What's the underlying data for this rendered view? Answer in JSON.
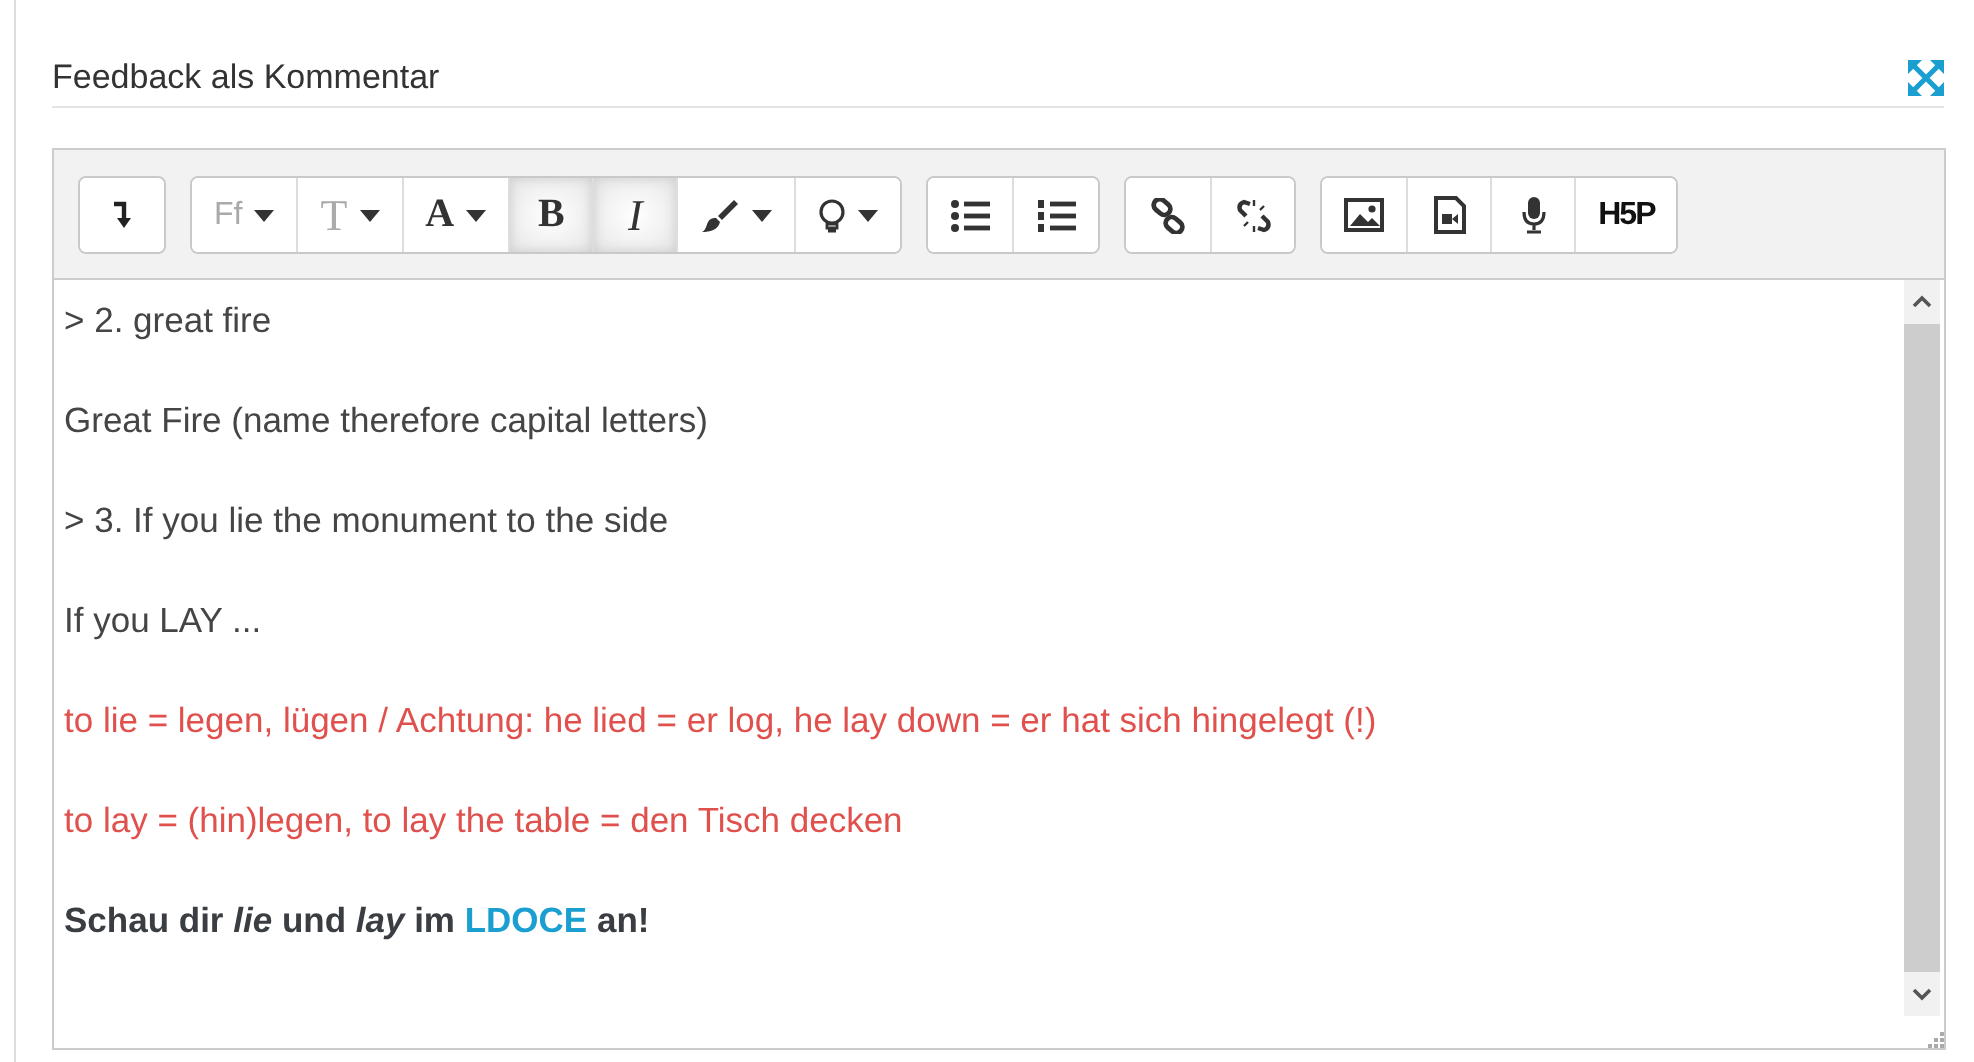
{
  "section": {
    "title": "Feedback als Kommentar"
  },
  "toolbar": {
    "groups": [
      {
        "buttons": [
          {
            "kind": "return",
            "pressed": false
          }
        ]
      },
      {
        "buttons": [
          {
            "kind": "font",
            "label": "Ff",
            "dropdown": true,
            "pressed": false
          },
          {
            "kind": "size",
            "label": "T",
            "dropdown": true,
            "pressed": false
          },
          {
            "kind": "serif",
            "label": "A",
            "dropdown": true,
            "pressed": false
          },
          {
            "kind": "serif",
            "label": "B",
            "dropdown": false,
            "pressed": true
          },
          {
            "kind": "italic",
            "label": "I",
            "dropdown": false,
            "pressed": true
          },
          {
            "kind": "brush",
            "dropdown": true,
            "pressed": false
          },
          {
            "kind": "bulb",
            "dropdown": true,
            "pressed": false
          }
        ]
      },
      {
        "buttons": [
          {
            "kind": "bullets",
            "pressed": false
          },
          {
            "kind": "numbered",
            "pressed": false
          }
        ]
      },
      {
        "buttons": [
          {
            "kind": "link",
            "pressed": false
          },
          {
            "kind": "unlink",
            "pressed": false
          }
        ]
      },
      {
        "buttons": [
          {
            "kind": "image",
            "pressed": false
          },
          {
            "kind": "video",
            "pressed": false
          },
          {
            "kind": "mic",
            "pressed": false
          },
          {
            "kind": "h5p",
            "label": "H5P",
            "pressed": false
          }
        ]
      }
    ]
  },
  "content": {
    "paragraphs": [
      {
        "kind": "plain",
        "text": "> 2. great fire",
        "color": "#454545"
      },
      {
        "kind": "plain",
        "text": "Great Fire (name therefore capital letters)",
        "color": "#454545"
      },
      {
        "kind": "plain",
        "text": "> 3. If you lie the monument to the side",
        "color": "#454545"
      },
      {
        "kind": "plain",
        "text": "If you LAY ...",
        "color": "#454545"
      },
      {
        "kind": "plain",
        "text": "to lie = legen, lügen / Achtung: he lied = er log, he lay down = er hat sich hingelegt (!)",
        "color": "#e0504c"
      },
      {
        "kind": "plain",
        "text": "to lay = (hin)legen, to lay the table = den Tisch decken",
        "color": "#e0504c"
      },
      {
        "kind": "linked",
        "before": "Schau dir *lie* und *lay* im",
        "link": "LDOCE",
        "after": "an!",
        "color": "#3a3d42"
      }
    ]
  }
}
